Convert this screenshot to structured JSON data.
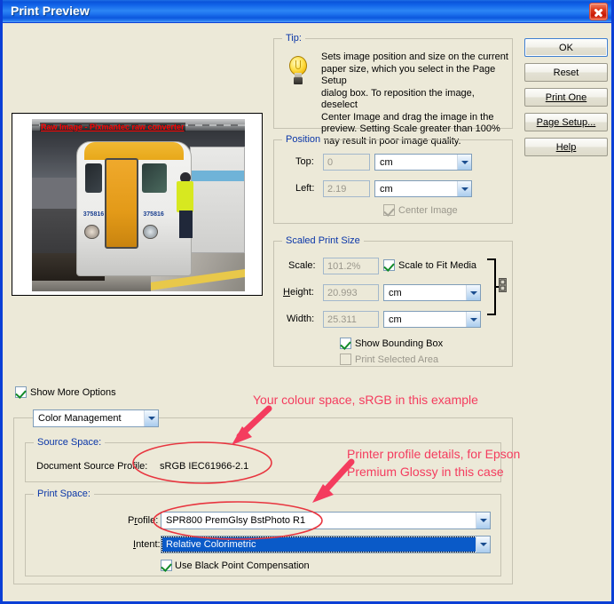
{
  "window": {
    "title": "Print Preview",
    "close_icon": "close-icon"
  },
  "preview": {
    "caption": "Raw Image - Pixmantec raw converter",
    "train_number_left": "375816",
    "train_number_right": "375816"
  },
  "tip": {
    "legend": "Tip:",
    "icon": "lightbulb-icon",
    "lines": [
      "Sets image position and size on the current",
      "paper  size, which you select in the Page Setup",
      "dialog box. To reposition the image,  deselect",
      "Center Image and drag the image in the",
      "preview. Setting Scale greater  than 100%",
      "may result in poor image quality."
    ]
  },
  "buttons": {
    "ok": "OK",
    "reset": "Reset",
    "print_one": "Print One",
    "page_setup": "Page Setup...",
    "help": "Help"
  },
  "position": {
    "legend": "Position",
    "top_label": "Top:",
    "top_value": "0",
    "top_unit": "cm",
    "left_label": "Left:",
    "left_value": "2.19",
    "left_unit": "cm",
    "center_image_label": "Center Image",
    "center_image_checked": true
  },
  "scaled_print_size": {
    "legend": "Scaled Print Size",
    "scale_label": "Scale:",
    "scale_value": "101.2%",
    "scale_to_fit_label": "Scale to Fit Media",
    "scale_to_fit_checked": true,
    "height_label": "Height:",
    "height_value": "20.993",
    "height_unit": "cm",
    "width_label": "Width:",
    "width_value": "25.311",
    "width_unit": "cm",
    "show_bounding_box_label": "Show Bounding Box",
    "show_bounding_box_checked": true,
    "print_selected_area_label": "Print Selected Area",
    "print_selected_area_checked": false,
    "link_icon": "chain-link-icon"
  },
  "more_options": {
    "show_more_options_label": "Show More Options",
    "show_more_options_checked": true,
    "section_select_value": "Color Management"
  },
  "source_space": {
    "legend": "Source Space:",
    "document_source_profile_label": "Document Source Profile:",
    "document_source_profile_value": "sRGB IEC61966-2.1"
  },
  "print_space": {
    "legend": "Print Space:",
    "profile_label": "Profile:",
    "profile_value": "SPR800 PremGlsy BstPhoto R1",
    "intent_label": "Intent:",
    "intent_value": "Relative Colorimetric",
    "black_point_label": "Use Black Point Compensation",
    "black_point_checked": true
  },
  "annotations": {
    "colour_space_note": "Your colour space, sRGB in this example",
    "printer_profile_note_line1": "Printer profile details, for Epson",
    "printer_profile_note_line2": "Premium Glossy in this case",
    "color": "#f43c5e"
  }
}
